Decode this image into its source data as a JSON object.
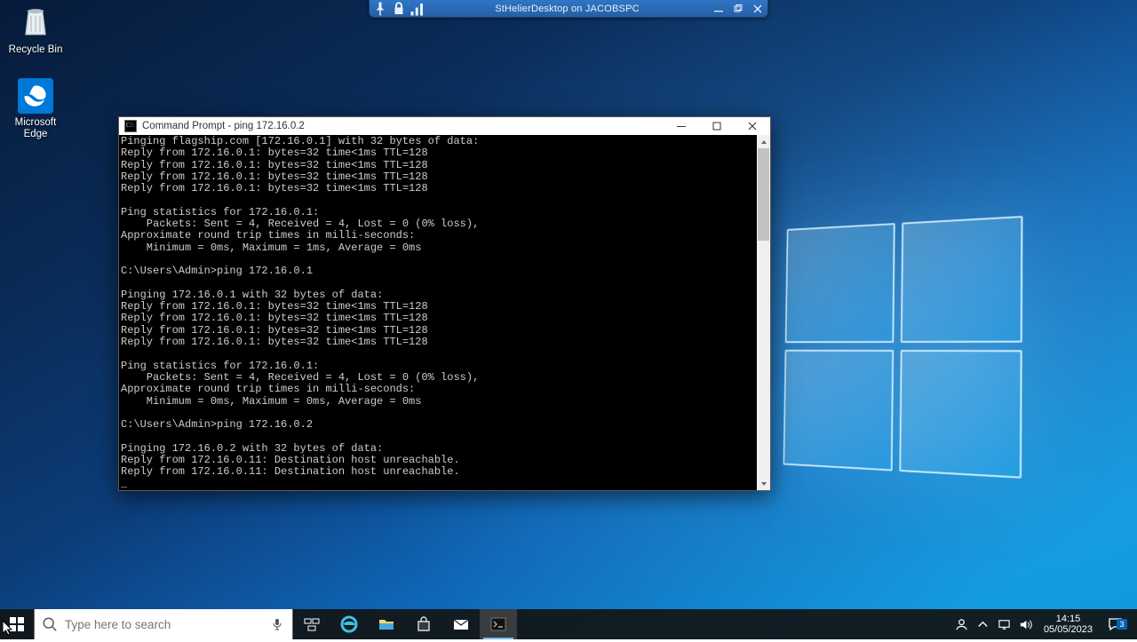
{
  "desktop_icons": {
    "recycle_bin": "Recycle Bin",
    "edge": "Microsoft Edge"
  },
  "remote_bar": {
    "title": "StHelierDesktop on JACOBSPC"
  },
  "cmd": {
    "title": "Command Prompt - ping  172.16.0.2",
    "lines": [
      "Pinging flagship.com [172.16.0.1] with 32 bytes of data:",
      "Reply from 172.16.0.1: bytes=32 time<1ms TTL=128",
      "Reply from 172.16.0.1: bytes=32 time<1ms TTL=128",
      "Reply from 172.16.0.1: bytes=32 time<1ms TTL=128",
      "Reply from 172.16.0.1: bytes=32 time<1ms TTL=128",
      "",
      "Ping statistics for 172.16.0.1:",
      "    Packets: Sent = 4, Received = 4, Lost = 0 (0% loss),",
      "Approximate round trip times in milli-seconds:",
      "    Minimum = 0ms, Maximum = 1ms, Average = 0ms",
      "",
      "C:\\Users\\Admin>ping 172.16.0.1",
      "",
      "Pinging 172.16.0.1 with 32 bytes of data:",
      "Reply from 172.16.0.1: bytes=32 time<1ms TTL=128",
      "Reply from 172.16.0.1: bytes=32 time<1ms TTL=128",
      "Reply from 172.16.0.1: bytes=32 time<1ms TTL=128",
      "Reply from 172.16.0.1: bytes=32 time<1ms TTL=128",
      "",
      "Ping statistics for 172.16.0.1:",
      "    Packets: Sent = 4, Received = 4, Lost = 0 (0% loss),",
      "Approximate round trip times in milli-seconds:",
      "    Minimum = 0ms, Maximum = 0ms, Average = 0ms",
      "",
      "C:\\Users\\Admin>ping 172.16.0.2",
      "",
      "Pinging 172.16.0.2 with 32 bytes of data:",
      "Reply from 172.16.0.11: Destination host unreachable.",
      "Reply from 172.16.0.11: Destination host unreachable.",
      "_"
    ]
  },
  "taskbar": {
    "search_placeholder": "Type here to search"
  },
  "tray": {
    "time": "14:15",
    "date": "05/05/2023",
    "notification_count": "3"
  }
}
